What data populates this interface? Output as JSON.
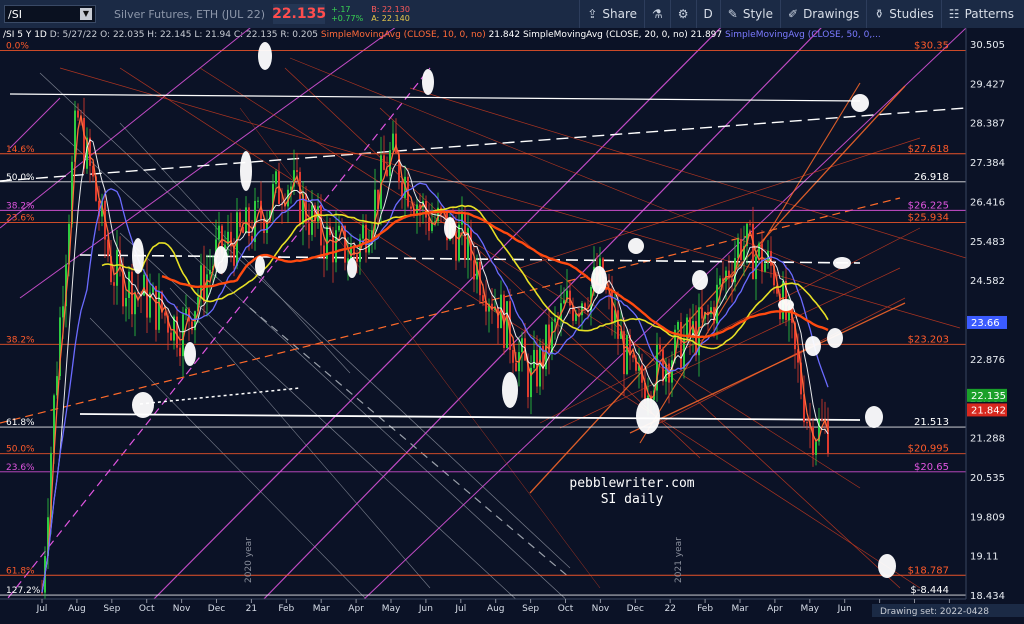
{
  "toolbar": {
    "symbol": "/SI",
    "instrument": "Silver Futures, ETH (JUL 22)",
    "last": "22.135",
    "change": "+.17",
    "change_pct": "+0.77%",
    "bid": "B: 22.130",
    "ask": "A: 22.140",
    "share": "Share",
    "period": "D",
    "style": "Style",
    "drawings": "Drawings",
    "studies": "Studies",
    "patterns": "Patterns"
  },
  "colors": {
    "bg": "#0b1226",
    "up": "#2ecc40",
    "down": "#e03a2e",
    "sma10": "#ff6a3a",
    "sma20": "#ffffff",
    "sma50": "#6b6bff",
    "sma200": "#ff4a10",
    "yellow": "#e7e025",
    "magenta": "#e055e0"
  },
  "chart_data": {
    "type": "line",
    "title": "/SI 5 Y 1D",
    "ohlc_text": [
      "D: 5/27/22",
      "O: 22.035",
      "H: 22.145",
      "L: 21.94",
      "C: 22.135",
      "R: 0.205"
    ],
    "studies": [
      {
        "label": "SimpleMovingAvg (CLOSE, 10, 0, no)",
        "value": "21.842",
        "color": "#ff6a3a"
      },
      {
        "label": "SimpleMovingAvg (CLOSE, 20, 0, no)",
        "value": "21.897",
        "color": "#ffffff"
      },
      {
        "label": "SimpleMovingAvg (CLOSE, 50, 0,...",
        "value": "",
        "color": "#7a7aff"
      }
    ],
    "x_ticks": [
      "Jul",
      "Aug",
      "Sep",
      "Oct",
      "Nov",
      "Dec",
      "21",
      "Feb",
      "Mar",
      "Apr",
      "May",
      "Jun",
      "Jul",
      "Aug",
      "Sep",
      "Oct",
      "Nov",
      "Dec",
      "22",
      "Feb",
      "Mar",
      "Apr",
      "May",
      "Jun",
      "Jul",
      "Aug",
      "Sep"
    ],
    "y_ticks": [
      "30.505",
      "29.427",
      "28.387",
      "27.384",
      "26.416",
      "25.483",
      "24.582",
      "23.714",
      "22.876",
      "22.068",
      "21.288",
      "20.535",
      "19.809",
      "19.11",
      "18.434"
    ],
    "ylim": [
      18.434,
      30.505
    ],
    "log_scale": true,
    "grid": false,
    "price_series": {
      "name": "/SI close",
      "x": [
        "2020-07",
        "2020-08",
        "2020-09",
        "2020-10",
        "2020-11",
        "2020-12",
        "2021-01",
        "2021-02",
        "2021-03",
        "2021-04",
        "2021-05",
        "2021-06",
        "2021-07",
        "2021-08",
        "2021-09",
        "2021-10",
        "2021-11",
        "2021-12",
        "2022-01",
        "2022-02",
        "2022-03",
        "2022-04",
        "2022-05"
      ],
      "values": [
        18.5,
        28.6,
        24.8,
        24.2,
        23.5,
        25.2,
        25.8,
        27.0,
        25.6,
        25.2,
        27.6,
        26.1,
        25.6,
        24.1,
        22.4,
        24.0,
        24.6,
        22.3,
        23.0,
        23.6,
        25.5,
        24.8,
        21.5
      ]
    },
    "last_badges": [
      {
        "value": "23.66",
        "color": "#3b5bff"
      },
      {
        "value": "22.135",
        "color": "#1aa02a"
      },
      {
        "value": "21.842",
        "color": "#d8281e"
      }
    ],
    "fib_levels": [
      {
        "pct": "0.0%",
        "price": "$30.35",
        "color": "#ff5a2a",
        "y": 30.35
      },
      {
        "pct": "14.6%",
        "price": "$27.618",
        "color": "#ff5a2a",
        "y": 27.618
      },
      {
        "pct": "50.0%",
        "price": "26.918",
        "color": "#ffffff",
        "y": 26.918
      },
      {
        "pct": "38.2%",
        "price": "$26.225",
        "color": "#e055e0",
        "y": 26.225
      },
      {
        "pct": "23.6%",
        "price": "$25.934",
        "color": "#ff5a2a",
        "y": 25.934
      },
      {
        "pct": "38.2%",
        "price": "$23.203",
        "color": "#ff5a2a",
        "y": 23.203
      },
      {
        "pct": "61.8%",
        "price": "21.513",
        "color": "#ffffff",
        "y": 21.513
      },
      {
        "pct": "50.0%",
        "price": "$20.995",
        "color": "#ff5a2a",
        "y": 20.995
      },
      {
        "pct": "23.6%",
        "price": "$20.65",
        "color": "#e055e0",
        "y": 20.65
      },
      {
        "pct": "61.8%",
        "price": "$18.787",
        "color": "#ff5a2a",
        "y": 18.787
      },
      {
        "pct": "127.2%",
        "price": "$-8.444",
        "color": "#ffffff",
        "y": 18.45
      }
    ],
    "annotations": [
      "pebblewriter.com",
      "SI daily",
      "2020 year",
      "2021 year"
    ],
    "drawing_set": "Drawing set: 2022-0428"
  }
}
